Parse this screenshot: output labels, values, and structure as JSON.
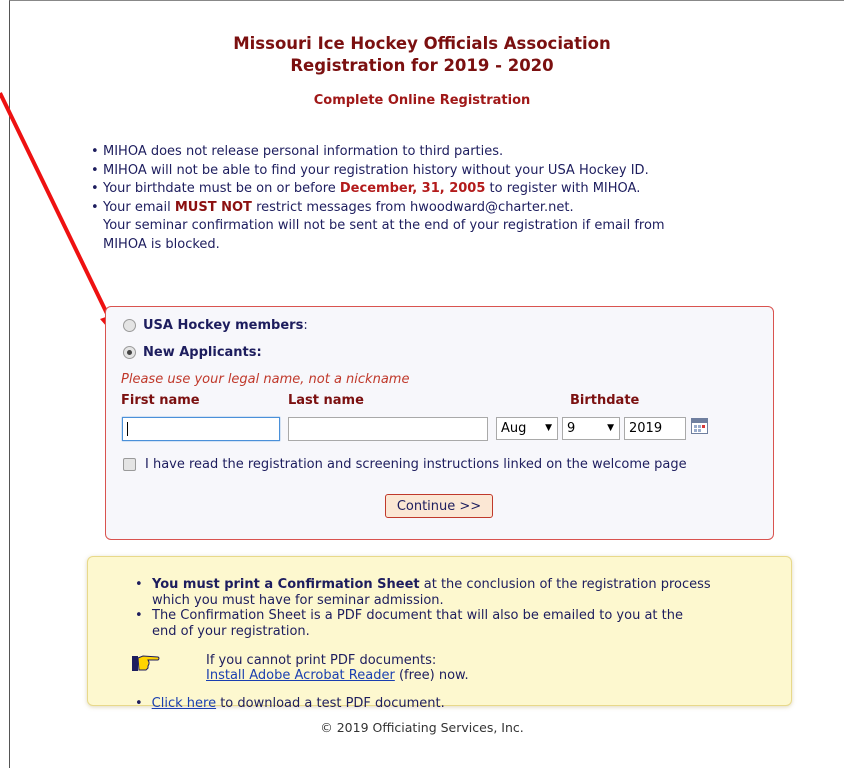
{
  "header": {
    "title_line1": "Missouri Ice Hockey Officials Association",
    "title_line2": "Registration for 2019 - 2020",
    "subtitle": "Complete Online Registration"
  },
  "notices": {
    "item1": "MIHOA does not release personal information to third parties.",
    "item2": "MIHOA will not be able to find your registration history without your USA Hockey ID.",
    "item3_pre": "Your birthdate must be on or before ",
    "item3_date": "December, 31, 2005",
    "item3_post": " to register with MIHOA.",
    "item4_pre": "Your email ",
    "item4_strong": "MUST NOT",
    "item4_post": " restrict messages from hwoodward@charter.net.",
    "item4_line2": "Your seminar confirmation will not be sent at the end of your registration if email from",
    "item4_line3": "MIHOA is blocked."
  },
  "registration": {
    "option_members": "USA Hockey members",
    "option_members_colon": ":",
    "option_new": "New Applicants:",
    "selected_option": "New Applicants",
    "hint": "Please use your legal name, not a nickname",
    "first_name_label": "First name",
    "last_name_label": "Last name",
    "birthdate_label": "Birthdate",
    "first_name_value": "",
    "last_name_value": "",
    "birth_month": "Aug",
    "birth_day": "9",
    "birth_year": "2019",
    "checkbox_label": "I have read the registration and screening instructions linked on the welcome page",
    "continue_label": "Continue >>"
  },
  "info": {
    "item1_strong": "You must print a Confirmation Sheet",
    "item1_rest": " at the conclusion of the registration process",
    "item1_line2": "which you must have for seminar admission.",
    "item2_line1": "The Confirmation Sheet is a PDF document that will also be emailed to you at the",
    "item2_line2": "end of your registration.",
    "pdf_line1": "If you cannot print PDF documents:",
    "pdf_link": "Install Adobe Acrobat Reader",
    "pdf_rest": " (free) now.",
    "test_link": "Click here",
    "test_rest": " to download a test PDF document."
  },
  "footer": {
    "text": "© 2019 Officiating Services, Inc."
  },
  "colors": {
    "title": "#7b1010",
    "accent_red": "#c0392b",
    "text": "#1d1d5e",
    "info_bg": "#fdf8cf",
    "link": "#1a3fb0",
    "annotation_arrow": "#ee1111"
  },
  "icons": {
    "calendar": "calendar-icon",
    "pointing_hand": "pointing-hand-icon",
    "annotation": "red-arrow-annotation"
  }
}
